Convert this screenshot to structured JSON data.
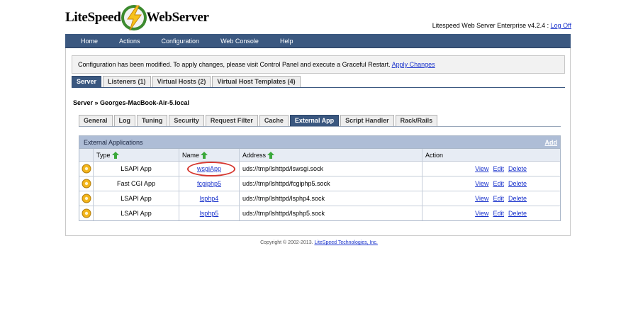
{
  "header": {
    "logo_left": "LiteSpeed",
    "logo_right": "WebServer",
    "version_text": "Litespeed Web Server Enterprise v4.2.4 :",
    "logoff": "Log Off"
  },
  "menu": [
    "Home",
    "Actions",
    "Configuration",
    "Web Console",
    "Help"
  ],
  "notice": {
    "text": "Configuration has been modified. To apply changes, please visit Control Panel and execute a Graceful Restart.",
    "link": "Apply Changes"
  },
  "main_tabs": [
    "Server",
    "Listeners (1)",
    "Virtual Hosts (2)",
    "Virtual Host Templates (4)"
  ],
  "breadcrumb": "Server » Georges-MacBook-Air-5.local",
  "sub_tabs": [
    "General",
    "Log",
    "Tuning",
    "Security",
    "Request Filter",
    "Cache",
    "External App",
    "Script Handler",
    "Rack/Rails"
  ],
  "table": {
    "title": "External Applications",
    "add": "Add",
    "headers": {
      "type": "Type",
      "name": "Name",
      "address": "Address",
      "action": "Action"
    },
    "rows": [
      {
        "type": "LSAPI App",
        "name": "wsgiApp",
        "address": "uds://tmp/lshttpd/lswsgi.sock"
      },
      {
        "type": "Fast CGI App",
        "name": "fcgiphp5",
        "address": "uds://tmp/lshttpd/fcgiphp5.sock"
      },
      {
        "type": "LSAPI App",
        "name": "lsphp4",
        "address": "uds://tmp/lshttpd/lsphp4.sock"
      },
      {
        "type": "LSAPI App",
        "name": "lsphp5",
        "address": "uds://tmp/lshttpd/lsphp5.sock"
      }
    ],
    "actions": {
      "view": "View",
      "edit": "Edit",
      "delete": "Delete"
    }
  },
  "footer": {
    "text": "Copyright © 2002-2013.",
    "link": "LiteSpeed Technologies, Inc."
  }
}
